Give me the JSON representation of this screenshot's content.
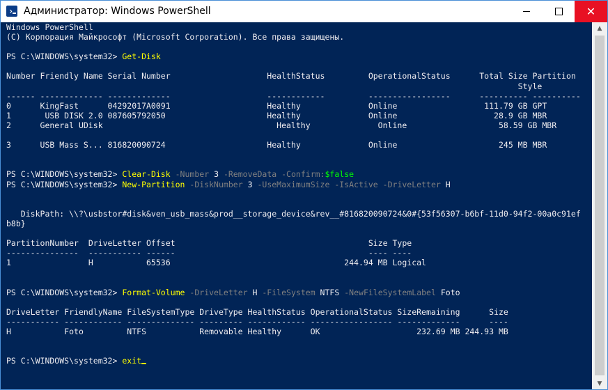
{
  "window": {
    "title": "Администратор: Windows PowerShell",
    "controls": {
      "minimize": "minimize",
      "maximize": "maximize",
      "close": "✕"
    },
    "colors": {
      "console_bg": "#012456",
      "text": "#eeedf0",
      "command": "#ffff00",
      "parameter": "#808080",
      "variable": "#00ff00",
      "close_button": "#e81123"
    }
  },
  "console": {
    "lines": [
      [
        {
          "t": "Windows PowerShell",
          "c": "out"
        }
      ],
      [
        {
          "t": "(C) Корпорация Майкрософт (Microsoft Corporation). Все права защищены.",
          "c": "out"
        }
      ],
      [],
      [
        {
          "t": "PS C:\\WINDOWS\\system32> ",
          "c": "out"
        },
        {
          "t": "Get-Disk",
          "c": "cmd"
        }
      ],
      [],
      [
        {
          "t": "Number Friendly Name Serial Number                    HealthStatus         OperationalStatus      Total Size Partition",
          "c": "out"
        }
      ],
      [
        {
          "t": "                                                                                                          Style",
          "c": "out"
        }
      ],
      [
        {
          "t": "------ ------------- -------------                    ------------         -----------------      ---------- ----------",
          "c": "out"
        }
      ],
      [
        {
          "t": "0      KingFast      04292017A0091                    Healthy              Online                  111.79 GB GPT",
          "c": "out"
        }
      ],
      [
        {
          "t": "1       USB DISK 2.0 087605792050                     Healthy              Online                    28.9 GB MBR",
          "c": "out"
        }
      ],
      [
        {
          "t": "2      General UDisk                                    Healthy              Online                   58.59 GB MBR",
          "c": "out"
        }
      ],
      [],
      [
        {
          "t": "3      USB Mass S... 816820090724                     Healthy              Online                     245 MB MBR",
          "c": "out"
        }
      ],
      [],
      [],
      [
        {
          "t": "PS C:\\WINDOWS\\system32> ",
          "c": "out"
        },
        {
          "t": "Clear-Disk",
          "c": "cmd"
        },
        {
          "t": " -Number ",
          "c": "par"
        },
        {
          "t": "3",
          "c": "arg"
        },
        {
          "t": " -RemoveData -Confirm:",
          "c": "par"
        },
        {
          "t": "$false",
          "c": "var"
        }
      ],
      [
        {
          "t": "PS C:\\WINDOWS\\system32> ",
          "c": "out"
        },
        {
          "t": "New-Partition",
          "c": "cmd"
        },
        {
          "t": " -DiskNumber ",
          "c": "par"
        },
        {
          "t": "3",
          "c": "arg"
        },
        {
          "t": " -UseMaximumSize -IsActive -DriveLetter ",
          "c": "par"
        },
        {
          "t": "H",
          "c": "arg"
        }
      ],
      [],
      [],
      [
        {
          "t": "   DiskPath: \\\\?\\usbstor#disk&ven_usb_mass&prod__storage_device&rev__#816820090724&0#{53f56307-b6bf-11d0-94f2-00a0c91ef",
          "c": "out"
        }
      ],
      [
        {
          "t": "b8b}",
          "c": "out"
        }
      ],
      [],
      [
        {
          "t": "PartitionNumber  DriveLetter Offset                                        Size Type",
          "c": "out"
        }
      ],
      [
        {
          "t": "---------------  ----------- ------                                        ---- ----",
          "c": "out"
        }
      ],
      [
        {
          "t": "1                H           65536                                    244.94 MB Logical",
          "c": "out"
        }
      ],
      [],
      [],
      [
        {
          "t": "PS C:\\WINDOWS\\system32> ",
          "c": "out"
        },
        {
          "t": "Format-Volume",
          "c": "cmd"
        },
        {
          "t": " -DriveLetter ",
          "c": "par"
        },
        {
          "t": "H",
          "c": "arg"
        },
        {
          "t": " -FileSystem ",
          "c": "par"
        },
        {
          "t": "NTFS",
          "c": "arg"
        },
        {
          "t": " -NewFileSystemLabel ",
          "c": "par"
        },
        {
          "t": "Foto",
          "c": "arg"
        }
      ],
      [],
      [
        {
          "t": "DriveLetter FriendlyName FileSystemType DriveType HealthStatus OperationalStatus SizeRemaining      Size",
          "c": "out"
        }
      ],
      [
        {
          "t": "----------- ------------ -------------- --------- ------------ ----------------- -------------      ----",
          "c": "out"
        }
      ],
      [
        {
          "t": "H           Foto         NTFS           Removable Healthy      OK                    232.69 MB 244.93 MB",
          "c": "out"
        }
      ],
      [],
      [],
      [
        {
          "t": "PS C:\\WINDOWS\\system32> ",
          "c": "out"
        },
        {
          "t": "exit",
          "c": "cmd"
        }
      ]
    ]
  },
  "scrollbar": {
    "up_arrow": "▲",
    "down_arrow": "▼"
  }
}
